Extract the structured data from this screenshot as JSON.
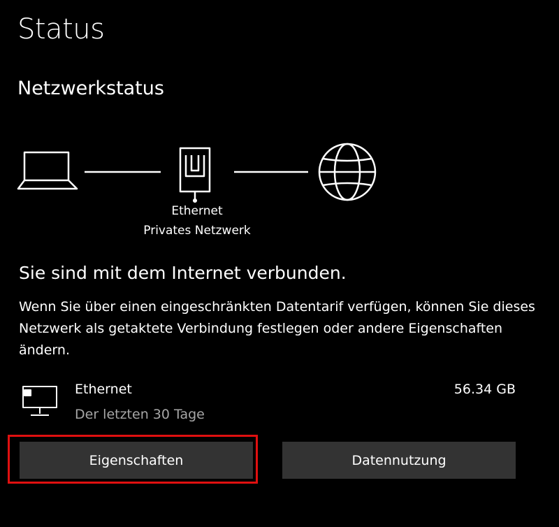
{
  "page": {
    "title": "Status"
  },
  "network_status": {
    "section_title": "Netzwerkstatus",
    "connection_name": "Ethernet",
    "network_profile": "Privates Netzwerk",
    "diagram_icons": [
      "laptop-icon",
      "ethernet-port-icon",
      "globe-icon"
    ]
  },
  "connection": {
    "heading": "Sie sind mit dem Internet verbunden.",
    "description": "Wenn Sie über einen eingeschränkten Datentarif verfügen, können Sie dieses Netzwerk als getaktete Verbindung festlegen oder andere Eigenschaften ändern."
  },
  "adapter": {
    "icon": "network-adapter-icon",
    "name": "Ethernet",
    "period": "Der letzten 30 Tage",
    "usage": "56.34 GB"
  },
  "buttons": {
    "properties_label": "Eigenschaften",
    "data_usage_label": "Datennutzung"
  },
  "colors": {
    "background": "#000000",
    "text": "#ffffff",
    "muted_text": "#a6a6a6",
    "button_background": "#333333",
    "highlight": "#e01010"
  }
}
